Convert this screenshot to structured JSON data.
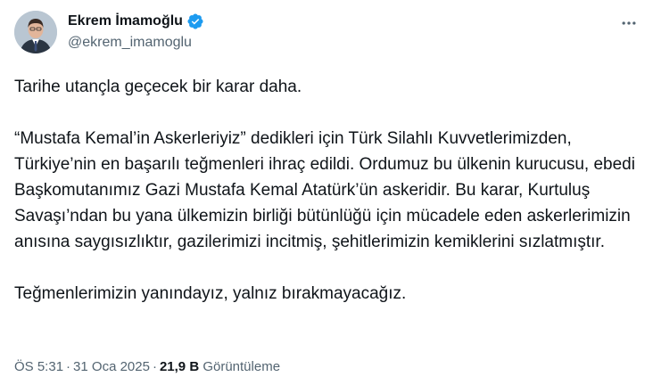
{
  "author": {
    "display_name": "Ekrem İmamoğlu",
    "handle": "@ekrem_imamoglu",
    "verified": true,
    "verified_color": "#1d9bf0"
  },
  "menu": {
    "icon": "more-horizontal-icon"
  },
  "tweet": {
    "paragraphs": [
      "Tarihe utançla geçecek bir karar daha.",
      "“Mustafa Kemal’in Askerleriyiz” dedikleri için Türk Silahlı Kuvvetlerimizden, Türkiye’nin en başarılı teğmenleri ihraç edildi. Ordumuz bu ülkenin kurucusu, ebedi Başkomutanımız Gazi Mustafa Kemal Atatürk’ün askeridir. Bu karar, Kurtuluş Savaşı’ndan bu yana ülkemizin birliği bütünlüğü için mücadele eden askerlerimizin anısına saygısızlıktır, gazilerimizi incitmiş, şehitlerimizin kemiklerini sızlatmıştır.",
      "Teğmenlerimizin yanındayız, yalnız bırakmayacağız."
    ]
  },
  "meta": {
    "time": "ÖS 5:31",
    "separator": "·",
    "date": "31 Oca 2025",
    "views_count": "21,9 B",
    "views_label": "Görüntüleme"
  }
}
